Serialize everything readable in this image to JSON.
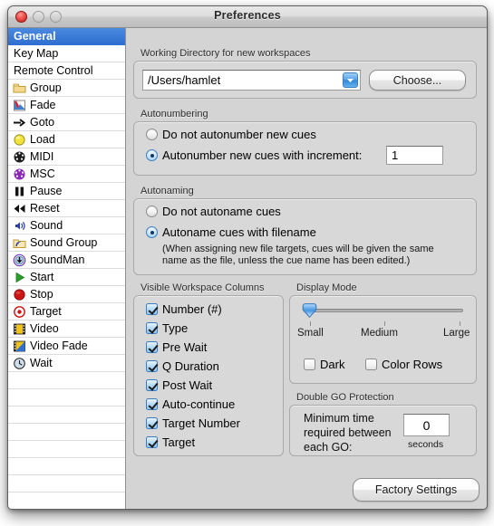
{
  "window": {
    "title": "Preferences",
    "controls": {
      "close": "close-button",
      "minimize": "minimize-button",
      "zoom": "zoom-button"
    }
  },
  "sidebar": {
    "items": [
      {
        "label": "General",
        "icon": "none",
        "selected": true
      },
      {
        "label": "Key Map",
        "icon": "none",
        "selected": false
      },
      {
        "label": "Remote Control",
        "icon": "none",
        "selected": false
      },
      {
        "label": "Group",
        "icon": "folder-icon",
        "selected": false
      },
      {
        "label": "Fade",
        "icon": "fade-icon",
        "selected": false
      },
      {
        "label": "Goto",
        "icon": "arrow-right-icon",
        "selected": false
      },
      {
        "label": "Load",
        "icon": "yellow-circle-icon",
        "selected": false
      },
      {
        "label": "MIDI",
        "icon": "midi-icon",
        "selected": false
      },
      {
        "label": "MSC",
        "icon": "msc-icon",
        "selected": false
      },
      {
        "label": "Pause",
        "icon": "pause-icon",
        "selected": false
      },
      {
        "label": "Reset",
        "icon": "rewind-icon",
        "selected": false
      },
      {
        "label": "Sound",
        "icon": "sound-icon",
        "selected": false
      },
      {
        "label": "Sound Group",
        "icon": "sound-group-icon",
        "selected": false
      },
      {
        "label": "SoundMan",
        "icon": "soundman-icon",
        "selected": false
      },
      {
        "label": "Start",
        "icon": "play-icon",
        "selected": false
      },
      {
        "label": "Stop",
        "icon": "stop-icon",
        "selected": false
      },
      {
        "label": "Target",
        "icon": "target-icon",
        "selected": false
      },
      {
        "label": "Video",
        "icon": "video-icon",
        "selected": false
      },
      {
        "label": "Video Fade",
        "icon": "video-fade-icon",
        "selected": false
      },
      {
        "label": "Wait",
        "icon": "clock-icon",
        "selected": false
      }
    ],
    "empty_rows": 8
  },
  "working_directory": {
    "group_label": "Working Directory for new workspaces",
    "path_value": "/Users/hamlet",
    "choose_label": "Choose..."
  },
  "autonumbering": {
    "group_label": "Autonumbering",
    "option_off": "Do not autonumber new cues",
    "option_on": "Autonumber new cues with increment:",
    "selected": "on",
    "increment_value": "1"
  },
  "autonaming": {
    "group_label": "Autonaming",
    "option_off": "Do not autoname cues",
    "option_on": "Autoname cues with filename",
    "selected": "on",
    "note": "(When assigning new file targets, cues will be given the same\nname as the file, unless the cue name has been edited.)"
  },
  "visible_columns": {
    "group_label": "Visible Workspace Columns",
    "items": [
      {
        "label": "Number (#)",
        "checked": true
      },
      {
        "label": "Type",
        "checked": true
      },
      {
        "label": "Pre Wait",
        "checked": true
      },
      {
        "label": "Q Duration",
        "checked": true
      },
      {
        "label": "Post Wait",
        "checked": true
      },
      {
        "label": "Auto-continue",
        "checked": true
      },
      {
        "label": "Target Number",
        "checked": true
      },
      {
        "label": "Target",
        "checked": true
      }
    ]
  },
  "display_mode": {
    "group_label": "Display Mode",
    "slider": {
      "value": "Small",
      "ticks": [
        "Small",
        "Medium",
        "Large"
      ],
      "position_percent": 0
    },
    "checkboxes": [
      {
        "label": "Dark",
        "checked": false
      },
      {
        "label": "Color Rows",
        "checked": false
      }
    ]
  },
  "double_go": {
    "group_label": "Double GO Protection",
    "description": "Minimum time\nrequired between\neach GO:",
    "value": "0",
    "units": "seconds"
  },
  "footer": {
    "factory_settings_label": "Factory Settings"
  },
  "colors": {
    "selection_blue": "#2f6fd0",
    "window_bg": "#d4d4d4",
    "sidebar_bg": "#ffffff"
  }
}
